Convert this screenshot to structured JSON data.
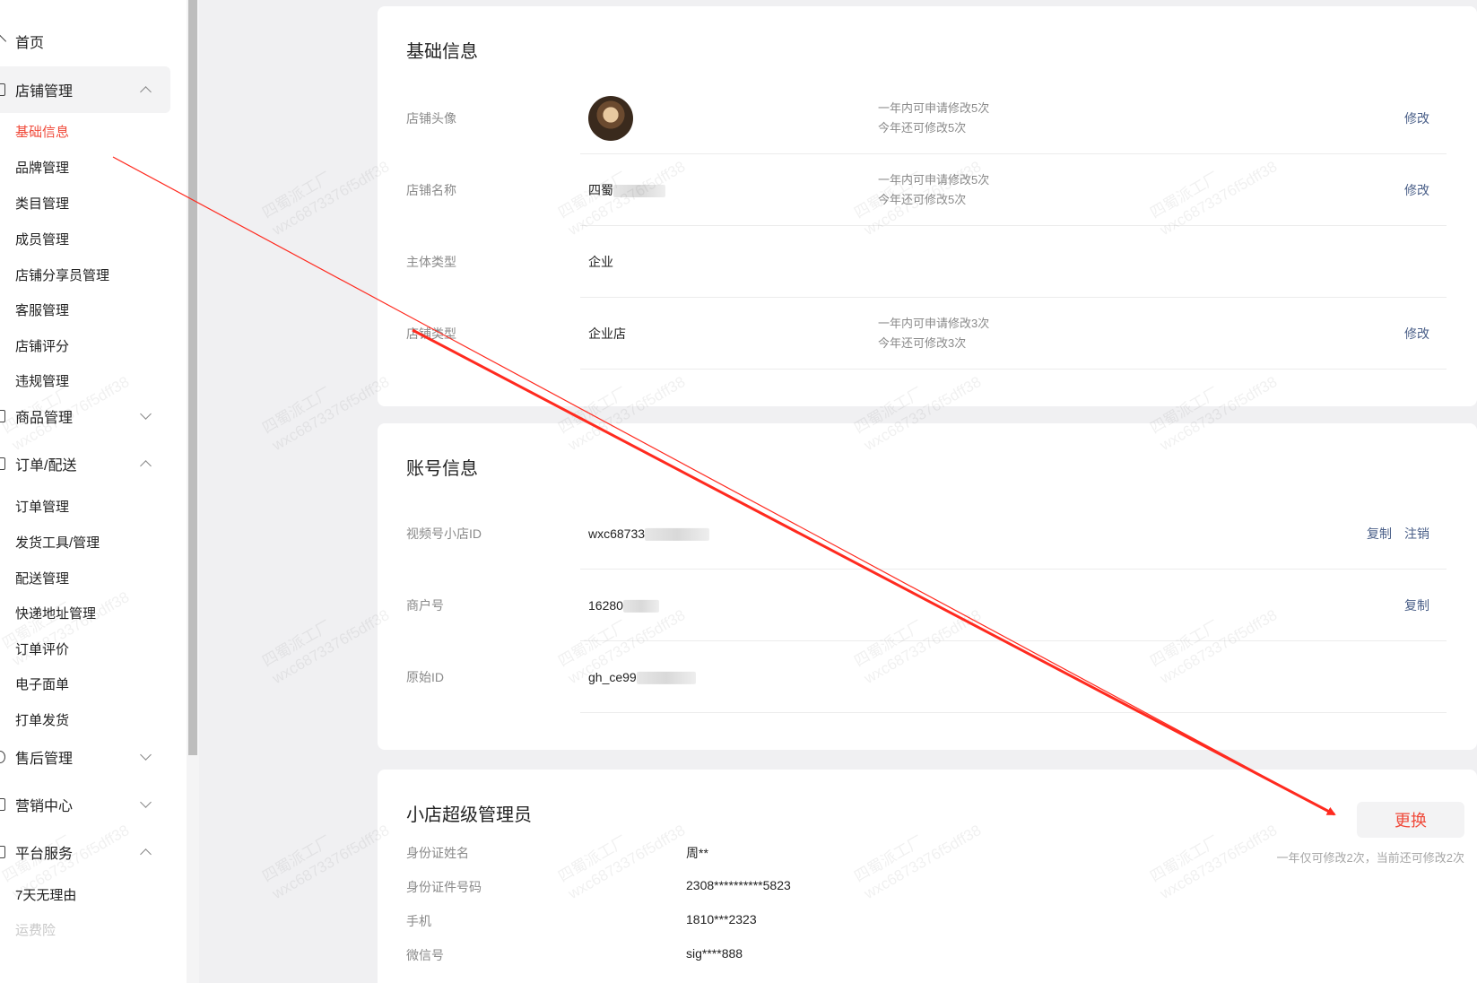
{
  "sidebar": {
    "home": "首页",
    "groups": {
      "store": "店铺管理",
      "goods": "商品管理",
      "order": "订单/配送",
      "aftersale": "售后管理",
      "marketing": "营销中心",
      "platform": "平台服务"
    },
    "store_items": [
      "基础信息",
      "品牌管理",
      "类目管理",
      "成员管理",
      "店铺分享员管理",
      "客服管理",
      "店铺评分",
      "违规管理"
    ],
    "order_items": [
      "订单管理",
      "发货工具/管理",
      "配送管理",
      "快递地址管理",
      "订单评价",
      "电子面单",
      "打单发货"
    ],
    "platform_items": [
      "7天无理由",
      "运费险"
    ],
    "active_item": "基础信息"
  },
  "basic_info": {
    "title": "基础信息",
    "rows": [
      {
        "label": "店铺头像",
        "note1": "一年内可申请修改5次",
        "note2": "今年还可修改5次",
        "action": "修改"
      },
      {
        "label": "店铺名称",
        "value": "四蜀",
        "note1": "一年内可申请修改5次",
        "note2": "今年还可修改5次",
        "action": "修改"
      },
      {
        "label": "主体类型",
        "value": "企业"
      },
      {
        "label": "店铺类型",
        "value": "企业店",
        "note1": "一年内可申请修改3次",
        "note2": "今年还可修改3次",
        "action": "修改"
      }
    ]
  },
  "account_info": {
    "title": "账号信息",
    "rows": [
      {
        "label": "视频号小店ID",
        "value": "wxc68733",
        "actions": [
          "复制",
          "注销"
        ]
      },
      {
        "label": "商户号",
        "value": "16280",
        "actions": [
          "复制"
        ]
      },
      {
        "label": "原始ID",
        "value": "gh_ce99"
      }
    ]
  },
  "admin": {
    "title": "小店超级管理员",
    "change_button": "更换",
    "note": "一年仅可修改2次，当前还可修改2次",
    "rows": [
      {
        "label": "身份证姓名",
        "value": "周**"
      },
      {
        "label": "身份证件号码",
        "value": "2308**********5823"
      },
      {
        "label": "手机",
        "value": "1810***2323"
      },
      {
        "label": "微信号",
        "value": "sig****888"
      }
    ]
  },
  "watermark_text": "四蜀派工厂\nwxc6873376f5dff38",
  "colors": {
    "accent": "#f04a3a",
    "link": "#4a5f88",
    "annotation": "#ff2a1f"
  }
}
